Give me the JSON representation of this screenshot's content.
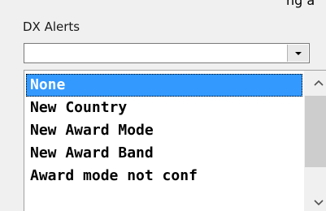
{
  "partial_text": "ng a",
  "group": {
    "label": "DX Alerts"
  },
  "combo": {
    "value": "",
    "dropdown_icon": "chevron-down-icon"
  },
  "list": {
    "items": [
      {
        "label": "None",
        "selected": true
      },
      {
        "label": "New Country",
        "selected": false
      },
      {
        "label": "New Award Mode",
        "selected": false
      },
      {
        "label": "New Award Band",
        "selected": false
      },
      {
        "label": "Award mode not conf",
        "selected": false
      }
    ],
    "scroll_up_icon": "chevron-up-icon",
    "scroll_down_icon": "chevron-down-icon"
  },
  "colors": {
    "selection": "#3399ff",
    "selection_text": "#ffffff",
    "background": "#f0f0f0"
  }
}
